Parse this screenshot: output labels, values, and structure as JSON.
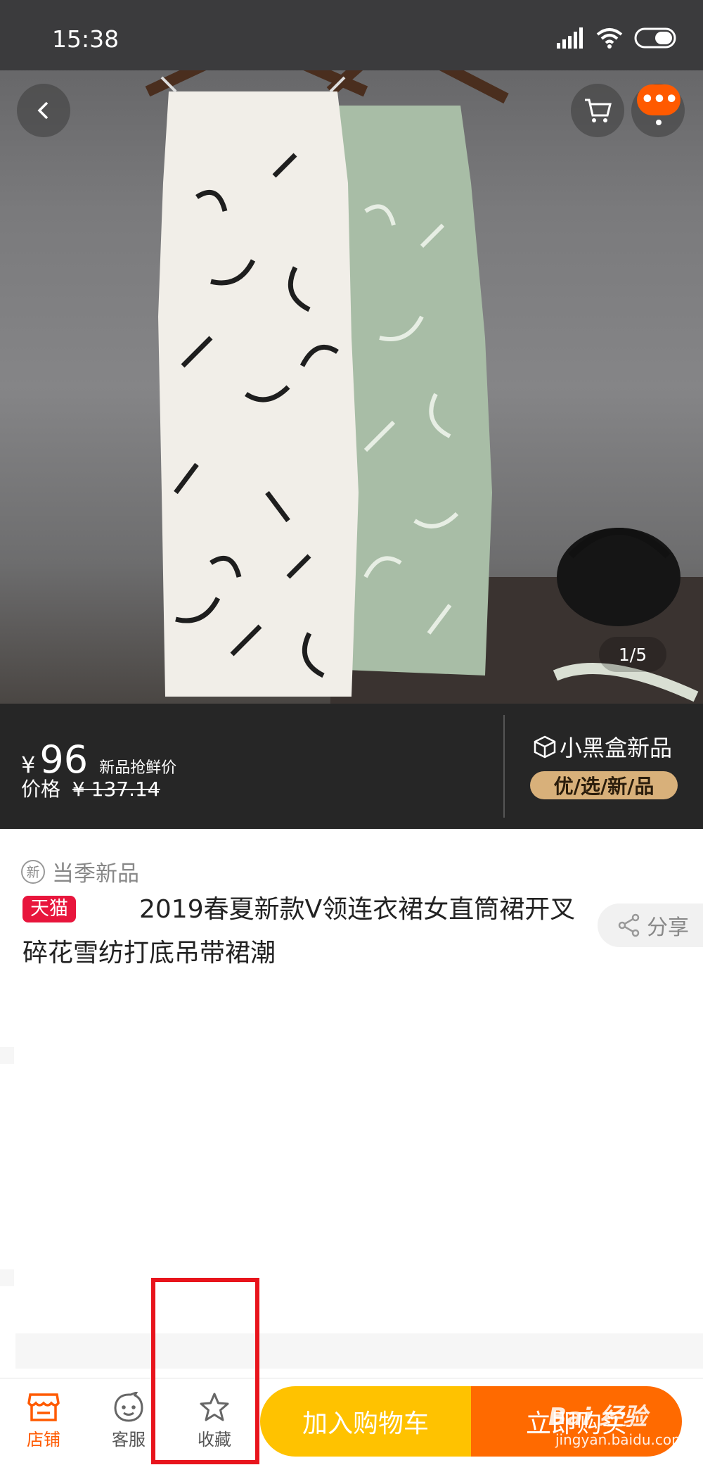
{
  "status_bar": {
    "time": "15:38"
  },
  "gallery": {
    "counter": "1/5"
  },
  "price": {
    "currency": "¥",
    "amount": "96",
    "tag": "新品抢鲜价",
    "original_label": "价格",
    "original_price": "¥ 137.14"
  },
  "blackbox": {
    "title": "小黑盒新品",
    "pill": "优/选/新/品"
  },
  "product": {
    "season_badge_char": "新",
    "season_label": "当季新品",
    "store_badge": "天猫",
    "title": "2019春夏新款V领连衣裙女直筒裙开叉碎花雪纺打底吊带裙潮"
  },
  "share": {
    "label": "分享"
  },
  "header": {
    "more_badge": "•••"
  },
  "bottom_bar": {
    "store_label": "店铺",
    "service_label": "客服",
    "favorite_label": "收藏",
    "add_to_cart_label": "加入购物车",
    "buy_now_label": "立即购买"
  },
  "watermark": {
    "main": "Bai 经验",
    "sub": "jingyan.baidu.com"
  },
  "colors": {
    "accent": "#ff5a00",
    "tmall_red": "#e8153c",
    "cart_yellow": "#ffc200",
    "buy_orange": "#ff6a00",
    "highlight_red": "#e8141c",
    "banner_gold": "#d8b07a"
  }
}
